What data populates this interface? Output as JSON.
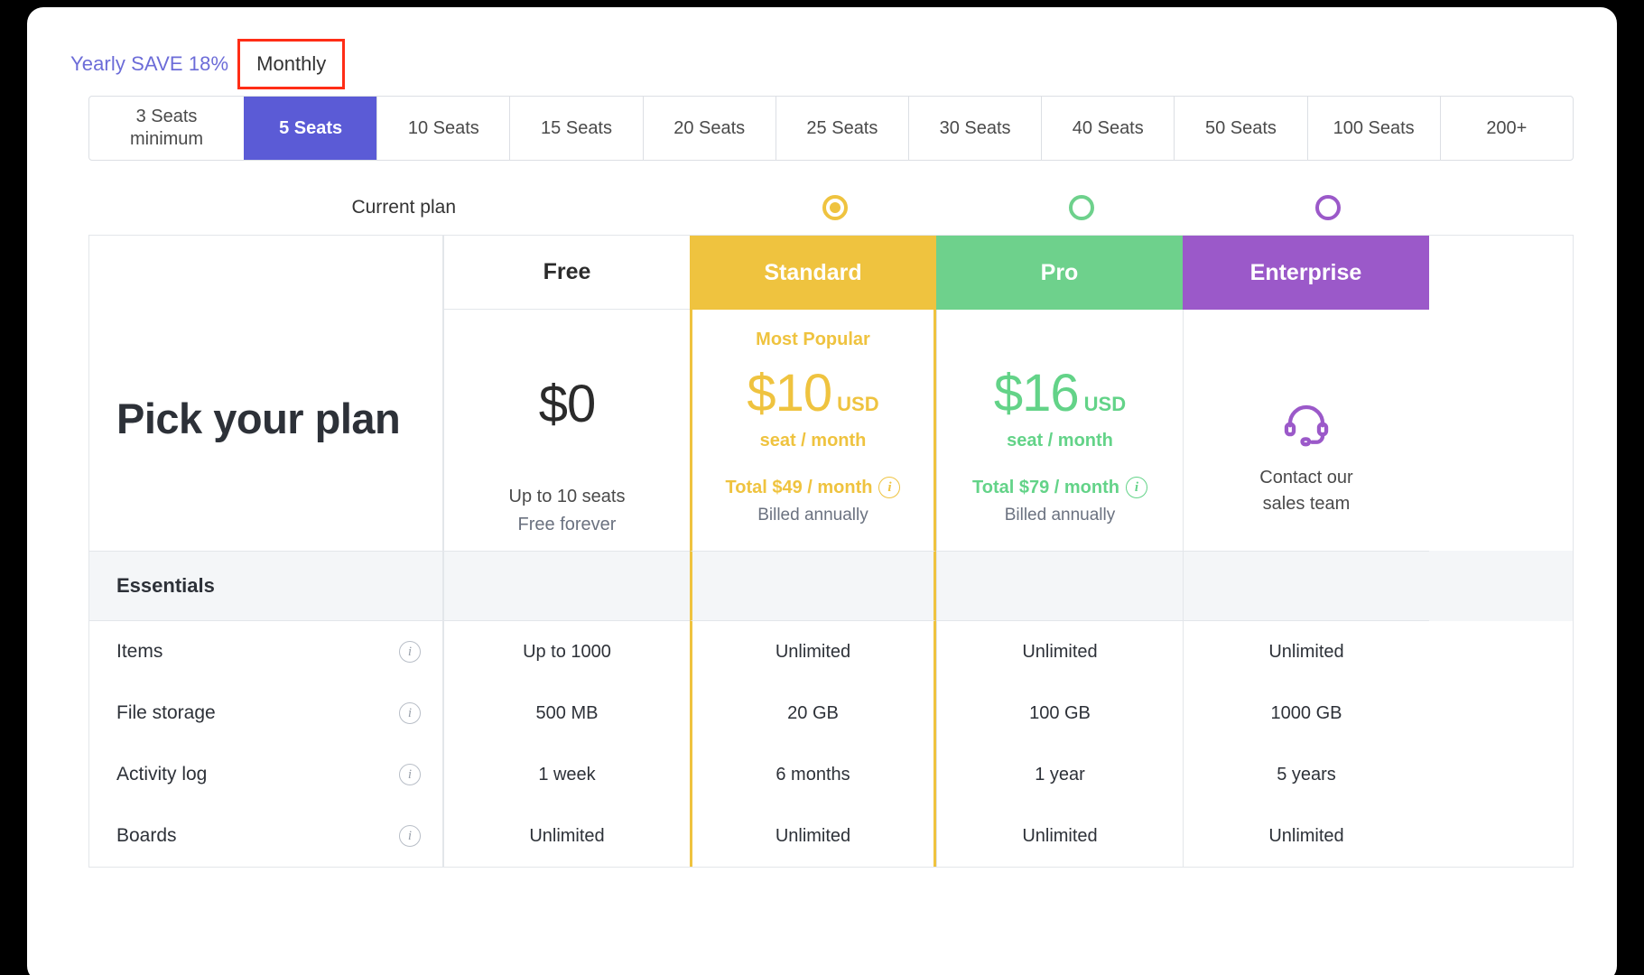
{
  "billing": {
    "yearly_label": "Yearly SAVE 18%",
    "monthly_label": "Monthly",
    "selected": "Monthly",
    "highlight_color": "#ff2d16"
  },
  "seats": {
    "options": [
      "3 Seats minimum",
      "5 Seats",
      "10 Seats",
      "15 Seats",
      "20 Seats",
      "25 Seats",
      "30 Seats",
      "40 Seats",
      "50 Seats",
      "100 Seats",
      "200+"
    ],
    "selected": "5 Seats",
    "selected_color": "#5b5bd6"
  },
  "current_plan": {
    "label": "Current plan",
    "selected_plan": "Standard"
  },
  "heading": {
    "title": "Pick your plan"
  },
  "plans": [
    {
      "name": "Free",
      "color": "#2b2b2b",
      "header_bg": "#ffffff",
      "badge": "",
      "price": "$0",
      "currency": "",
      "per": "",
      "note_line1": "Up to 10 seats",
      "note_line2": "Free forever",
      "radio": "none",
      "radio_selected": false
    },
    {
      "name": "Standard",
      "color": "#efc33f",
      "header_bg": "#efc33f",
      "badge": "Most Popular",
      "price": "$10",
      "currency": "USD",
      "per": "seat / month",
      "note_line1": "Total $49 / month",
      "note_line2": "Billed annually",
      "radio": "#efc33f",
      "radio_selected": true
    },
    {
      "name": "Pro",
      "color": "#63d388",
      "header_bg": "#6ed18c",
      "badge": "",
      "price": "$16",
      "currency": "USD",
      "per": "seat / month",
      "note_line1": "Total $79 / month",
      "note_line2": "Billed annually",
      "radio": "#6ed18c",
      "radio_selected": false
    },
    {
      "name": "Enterprise",
      "color": "#9b59c9",
      "header_bg": "#9b59c9",
      "badge": "",
      "price": "",
      "currency": "",
      "per": "",
      "note_line1": "Contact our",
      "note_line2": "sales team",
      "radio": "#9b59c9",
      "radio_selected": false,
      "icon": "headset-icon"
    }
  ],
  "sections": [
    {
      "title": "Essentials",
      "features": [
        {
          "name": "Items",
          "info": "info-icon",
          "values": [
            "Up to 1000",
            "Unlimited",
            "Unlimited",
            "Unlimited"
          ]
        },
        {
          "name": "File storage",
          "info": "info-icon",
          "values": [
            "500 MB",
            "20 GB",
            "100 GB",
            "1000 GB"
          ]
        },
        {
          "name": "Activity log",
          "info": "info-icon",
          "values": [
            "1 week",
            "6 months",
            "1 year",
            "5 years"
          ]
        },
        {
          "name": "Boards",
          "info": "info-icon",
          "values": [
            "Unlimited",
            "Unlimited",
            "Unlimited",
            "Unlimited"
          ]
        }
      ]
    }
  ]
}
